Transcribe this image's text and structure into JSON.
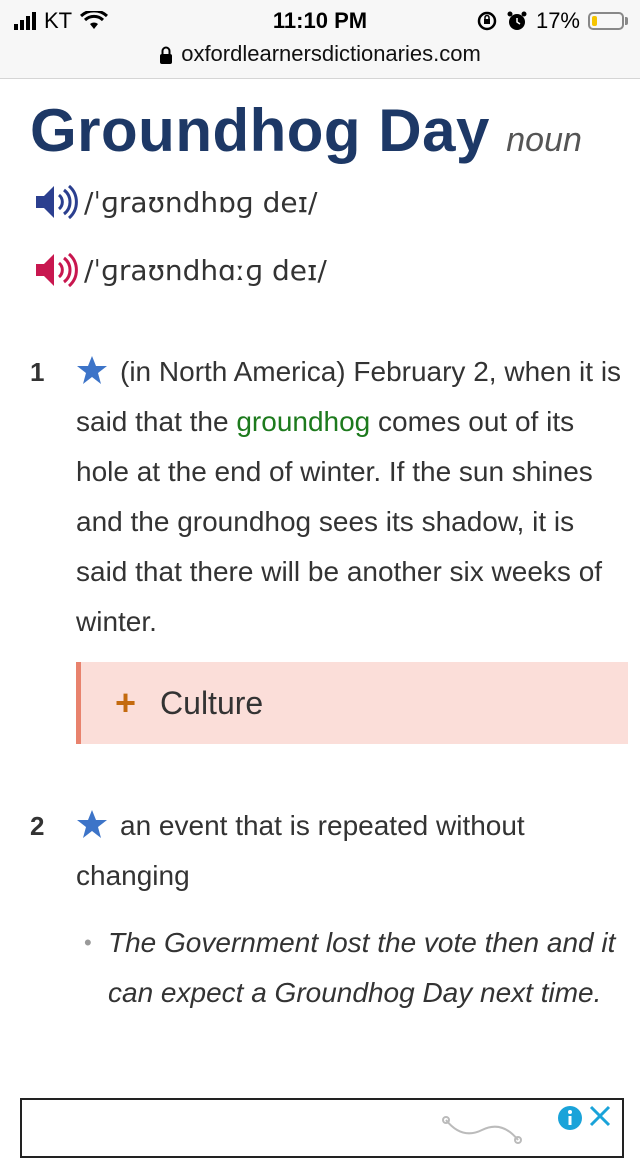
{
  "status_bar": {
    "carrier": "KT",
    "time": "11:10 PM",
    "battery_percent": "17%",
    "battery_level": 0.17,
    "icons": [
      "signal-icon",
      "wifi-icon",
      "rotation-lock-icon",
      "alarm-icon",
      "battery-icon"
    ]
  },
  "browser": {
    "url": "oxfordlearnersdictionaries.com",
    "icon": "lock-icon"
  },
  "entry": {
    "headword": "Groundhog Day",
    "part_of_speech": "noun",
    "pronunciations": [
      {
        "variant": "uk",
        "phonetic": "/ˈɡraʊndhɒɡ deɪ/",
        "icon_color": "#2b3f8f"
      },
      {
        "variant": "us",
        "phonetic": "/ˈɡraʊndhɑːɡ deɪ/",
        "icon_color": "#c8174f"
      }
    ],
    "senses": [
      {
        "number": "1",
        "text_before": "(in North America) February 2, when it is said that the ",
        "xref": "groundhog",
        "text_after": " comes out of its hole at the end of winter. If the sun shines and the groundhog sees its shadow, it is said that there will be another six weeks of winter."
      },
      {
        "number": "2",
        "text": "an event that is repeated without changing",
        "example": "The Government lost the vote then and it can expect a Groundhog Day next time."
      }
    ],
    "culture_box": {
      "plus": "+",
      "label": "Culture"
    }
  },
  "colors": {
    "headword": "#1d3866",
    "xref": "#1d7a1d",
    "star": "#3d74c8",
    "culture_bg": "#fbded9",
    "culture_border": "#e8826d",
    "culture_plus": "#c46a0e"
  },
  "ad": {
    "icons": [
      "info-icon",
      "close-icon"
    ]
  }
}
